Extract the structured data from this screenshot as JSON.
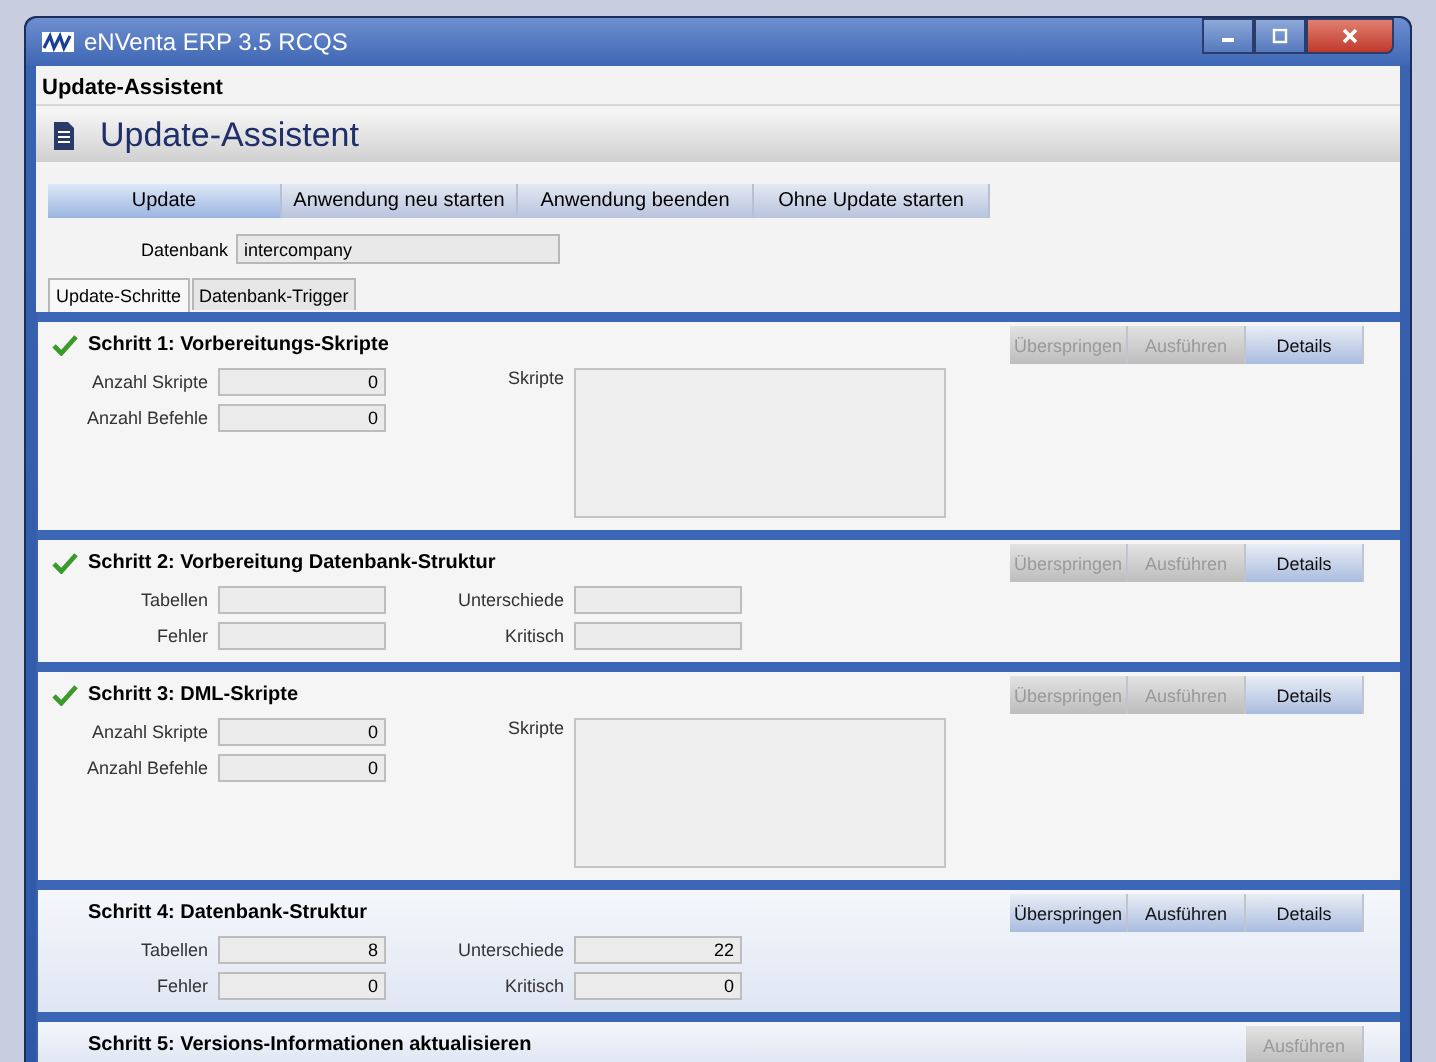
{
  "window": {
    "title": "eNVenta ERP 3.5 RCQS"
  },
  "dialog_title": "Update-Assistent",
  "header": {
    "title": "Update-Assistent"
  },
  "toolbar": [
    {
      "label": "Update",
      "selected": true
    },
    {
      "label": "Anwendung neu starten",
      "selected": false
    },
    {
      "label": "Anwendung beenden",
      "selected": false
    },
    {
      "label": "Ohne Update starten",
      "selected": false
    }
  ],
  "database": {
    "label": "Datenbank",
    "value": "intercompany"
  },
  "tabs": [
    {
      "label": "Update-Schritte",
      "selected": true
    },
    {
      "label": "Datenbank-Trigger",
      "selected": false
    }
  ],
  "steps": [
    {
      "title": "Schritt 1:  Vorbereitungs-Skripte",
      "done": true,
      "left": [
        {
          "label": "Anzahl Skripte",
          "value": "0"
        },
        {
          "label": "Anzahl Befehle",
          "value": "0"
        }
      ],
      "right": [
        {
          "kind": "textarea",
          "label": "Skripte"
        }
      ],
      "buttons": [
        {
          "label": "Überspringen",
          "disabled": true
        },
        {
          "label": "Ausführen",
          "disabled": true
        },
        {
          "label": "Details",
          "disabled": false
        }
      ]
    },
    {
      "title": "Schritt 2:  Vorbereitung Datenbank-Struktur",
      "done": true,
      "left": [
        {
          "label": "Tabellen"
        },
        {
          "label": "Fehler"
        }
      ],
      "right": [
        {
          "kind": "field",
          "label": "Unterschiede"
        },
        {
          "kind": "field",
          "label": "Kritisch"
        }
      ],
      "buttons": [
        {
          "label": "Überspringen",
          "disabled": true
        },
        {
          "label": "Ausführen",
          "disabled": true
        },
        {
          "label": "Details",
          "disabled": false
        }
      ]
    },
    {
      "title": "Schritt 3:  DML-Skripte",
      "done": true,
      "left": [
        {
          "label": "Anzahl Skripte",
          "value": "0"
        },
        {
          "label": "Anzahl Befehle",
          "value": "0"
        }
      ],
      "right": [
        {
          "kind": "textarea",
          "label": "Skripte"
        }
      ],
      "buttons": [
        {
          "label": "Überspringen",
          "disabled": true
        },
        {
          "label": "Ausführen",
          "disabled": true
        },
        {
          "label": "Details",
          "disabled": false
        }
      ]
    },
    {
      "title": "Schritt 4:  Datenbank-Struktur",
      "done": false,
      "left": [
        {
          "label": "Tabellen",
          "value": "8"
        },
        {
          "label": "Fehler",
          "value": "0"
        }
      ],
      "right": [
        {
          "kind": "field",
          "label": "Unterschiede",
          "value": "22"
        },
        {
          "kind": "field",
          "label": "Kritisch",
          "value": "0"
        }
      ],
      "buttons": [
        {
          "label": "Überspringen",
          "disabled": false
        },
        {
          "label": "Ausführen",
          "disabled": false
        },
        {
          "label": "Details",
          "disabled": false
        }
      ]
    },
    {
      "title": "Schritt 5:  Versions-Informationen aktualisieren",
      "done": false,
      "buttons": [
        {
          "label": "Ausführen",
          "disabled": true
        }
      ]
    }
  ]
}
